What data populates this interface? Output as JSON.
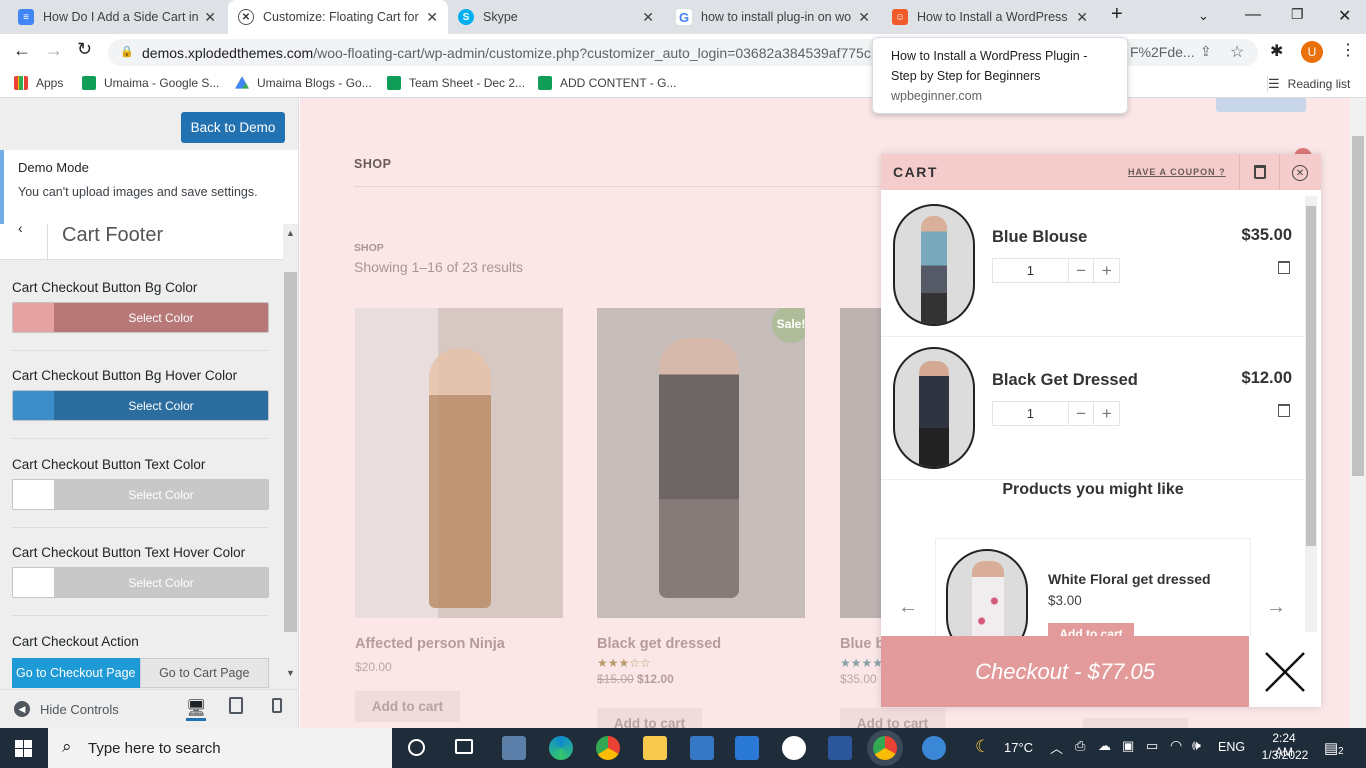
{
  "browser": {
    "tabs": [
      {
        "title": "How Do I Add a Side Cart in W",
        "icon": "docs-icon"
      },
      {
        "title": "Customize: Floating Cart for W",
        "icon": "xploded-icon"
      },
      {
        "title": "Skype",
        "icon": "skype-icon"
      },
      {
        "title": "how to install plug-in on wor",
        "icon": "google-icon"
      },
      {
        "title": "How to Install a WordPress P",
        "icon": "wpbeginner-icon"
      }
    ],
    "url_host": "demos.xplodedthemes.com",
    "url_path": "/woo-floating-cart/wp-admin/customize.php?customizer_auto_login=03682a384539af775c",
    "url_tail": "F%2Fde...",
    "profile_initial": "U",
    "bookmarks": [
      "Apps",
      "Umaima - Google S...",
      "Umaima Blogs - Go...",
      "Team Sheet - Dec 2...",
      "ADD CONTENT - G..."
    ],
    "reading_list": "Reading list",
    "tooltip": {
      "title": "How to Install a WordPress Plugin - Step by Step for Beginners",
      "domain": "wpbeginner.com"
    }
  },
  "customizer": {
    "back_button": "Back to Demo",
    "demo_mode_title": "Demo Mode",
    "demo_mode_text": "You can't upload images and save settings.",
    "section_title": "Cart Footer",
    "controls": [
      {
        "label": "Cart Checkout Button Bg Color",
        "button": "Select Color",
        "swatch": "#e6a2a2",
        "bar": "#b87878"
      },
      {
        "label": "Cart Checkout Button Bg Hover Color",
        "button": "Select Color",
        "swatch": "#3d8ec8",
        "bar": "#2b6d9e"
      },
      {
        "label": "Cart Checkout Button Text Color",
        "button": "Select Color",
        "swatch": "#ffffff",
        "bar": "#c8c8c8"
      },
      {
        "label": "Cart Checkout Button Text Hover Color",
        "button": "Select Color",
        "swatch": "#ffffff",
        "bar": "#c8c8c8"
      }
    ],
    "checkout_action_label": "Cart Checkout Action",
    "checkout_options": [
      "Go to Checkout Page",
      "Go to Cart Page"
    ],
    "hide_controls": "Hide Controls"
  },
  "shop": {
    "nav": "SHOP",
    "breadcrumb": "SHOP",
    "result_count": "Showing 1–16 of 23 results",
    "sale_badge": "Sale!",
    "products": [
      {
        "name": "Affected person Ninja",
        "price": "$20.00",
        "button": "Add to cart"
      },
      {
        "name": "Black get dressed",
        "old_price": "$15.00",
        "price": "$12.00",
        "button": "Add to cart",
        "rating": 3
      },
      {
        "name": "Blue b",
        "price": "$35.00",
        "button": "Add to cart",
        "rating": 4
      }
    ]
  },
  "cart": {
    "title": "CART",
    "coupon": "HAVE A COUPON ?",
    "items": [
      {
        "name": "Blue Blouse",
        "price": "$35.00",
        "qty": "1"
      },
      {
        "name": "Black Get Dressed",
        "price": "$12.00",
        "qty": "1"
      }
    ],
    "suggest_title": "Products you might like",
    "suggest": {
      "name": "White Floral get dressed",
      "price": "$3.00",
      "button": "Add to cart"
    },
    "checkout": "Checkout - $77.05"
  },
  "taskbar": {
    "search_placeholder": "Type here to search",
    "weather": "17°C",
    "lang": "ENG",
    "time": "2:24 AM",
    "date": "1/3/2022",
    "notification_count": "2"
  }
}
